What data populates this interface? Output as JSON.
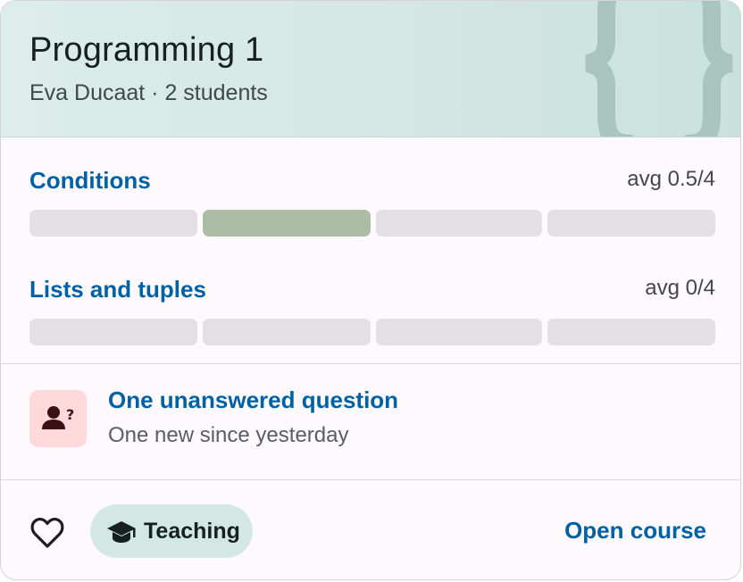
{
  "course": {
    "title": "Programming 1",
    "subtitle": "Eva Ducaat · 2 students",
    "header_icon": "curly-braces-icon"
  },
  "progress": [
    {
      "topic": "Conditions",
      "avg_label": "avg 0.5/4",
      "segments": 4,
      "filled_segment_index": 1
    },
    {
      "topic": "Lists and tuples",
      "avg_label": "avg 0/4",
      "segments": 4,
      "filled_segment_index": null
    }
  ],
  "questions": {
    "icon": "person-question-icon",
    "title": "One unanswered question",
    "subtitle": "One new since yesterday"
  },
  "footer": {
    "favorite_icon": "heart-outline-icon",
    "role_chip": {
      "icon": "graduation-cap-icon",
      "label": "Teaching"
    },
    "open_label": "Open course"
  },
  "colors": {
    "accent_link": "#0061a4",
    "header_bg": "#d3e7e4",
    "bar_empty": "#e3e0e5",
    "bar_filled": "#abbea5",
    "question_icon_bg": "#ffd9dc",
    "chip_bg": "#d3e8e3"
  }
}
